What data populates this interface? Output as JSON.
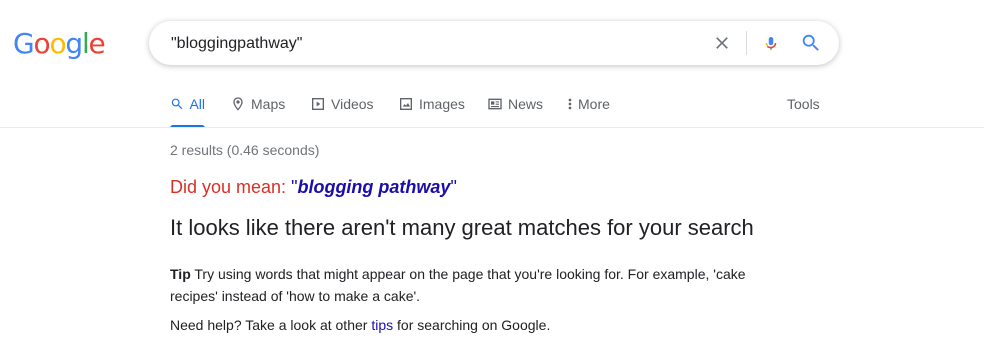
{
  "logo": {
    "letters": [
      "G",
      "o",
      "o",
      "g",
      "l",
      "e"
    ],
    "colors": [
      "#4285f4",
      "#ea4335",
      "#fbbc05",
      "#4285f4",
      "#34a853",
      "#ea4335"
    ]
  },
  "search": {
    "query": "\"bloggingpathway\""
  },
  "icons": {
    "clear": "close-icon",
    "mic": "microphone-icon",
    "search": "search-icon"
  },
  "tabs": [
    {
      "label": "All",
      "icon": "search-icon",
      "active": true
    },
    {
      "label": "Maps",
      "icon": "map-pin-icon"
    },
    {
      "label": "Videos",
      "icon": "video-icon"
    },
    {
      "label": "Images",
      "icon": "image-icon"
    },
    {
      "label": "News",
      "icon": "news-icon"
    },
    {
      "label": "More",
      "icon": "more-vertical-icon"
    }
  ],
  "tools_label": "Tools",
  "stats": "2 results (0.46 seconds)",
  "did_you_mean": {
    "prefix": "Did you mean: ",
    "open_quote": "\"",
    "suggestion": "blogging pathway",
    "close_quote": "\""
  },
  "headline": "It looks like there aren't many great matches for your search",
  "tip": {
    "label": "Tip",
    "text": " Try using words that might appear on the page that you're looking for. For example, 'cake recipes' instead of 'how to make a cake'."
  },
  "help": {
    "before": "Need help? Take a look at other ",
    "link": "tips",
    "after": " for searching on Google."
  },
  "colors": {
    "accent": "#1a73e8",
    "link": "#1a0dab",
    "dym_red": "#d93025",
    "muted": "#70757a"
  }
}
